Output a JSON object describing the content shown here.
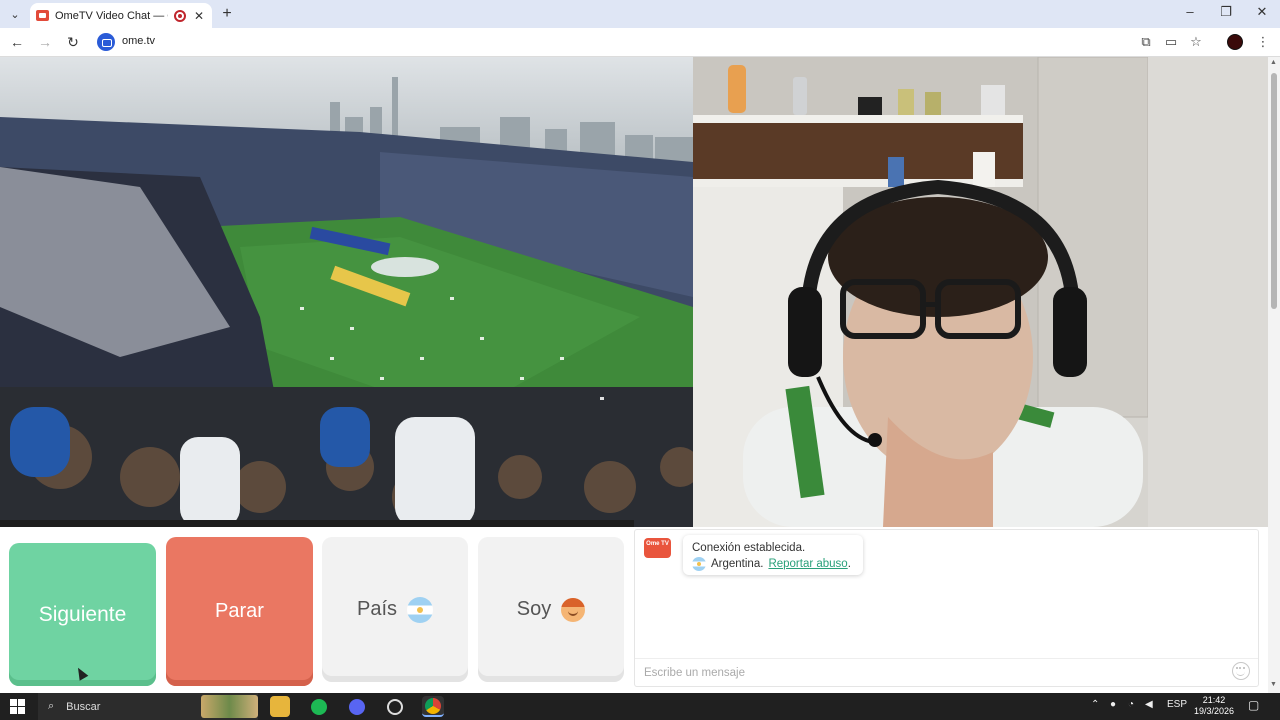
{
  "browser": {
    "tab_title": "OmeTV Video Chat — Ome",
    "tab_close": "✕",
    "new_tab": "+",
    "url": "ome.tv"
  },
  "buttons": {
    "next": "Siguiente",
    "stop": "Parar",
    "country": "País",
    "gender": "Soy"
  },
  "chat": {
    "logo_text": "Ome TV",
    "status": "Conexión establecida.",
    "country_name": "Argentina.",
    "report_link": "Reportar abuso",
    "report_suffix": ".",
    "input_placeholder": "Escribe un mensaje"
  },
  "taskbar": {
    "search_label": "Buscar",
    "language": "ESP",
    "time": "21:42",
    "date": "19/3/2026"
  },
  "colors": {
    "next": "#6fd3a2",
    "stop": "#ea7762",
    "neutral": "#f2f2f2",
    "link": "#2aa07a",
    "brand": "#e9553d"
  }
}
